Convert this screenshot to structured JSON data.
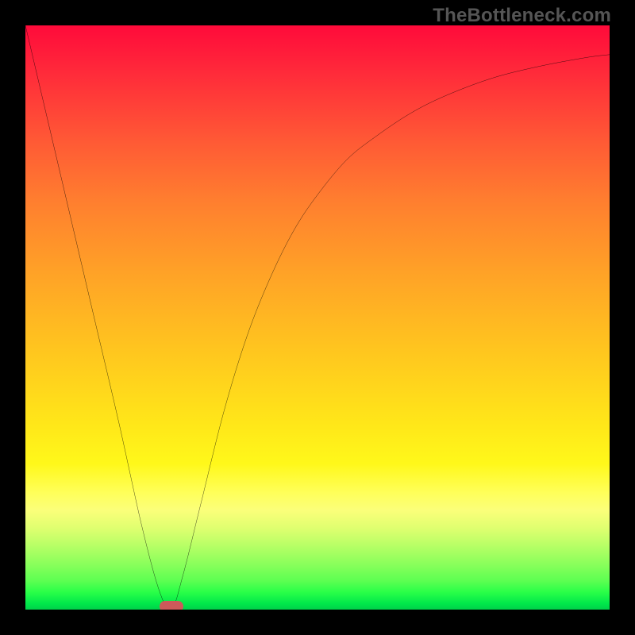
{
  "watermark_text": "TheBottleneck.com",
  "chart_data": {
    "type": "line",
    "title": "",
    "xlabel": "",
    "ylabel": "",
    "xlim": [
      0,
      100
    ],
    "ylim": [
      0,
      100
    ],
    "grid": false,
    "legend": false,
    "series": [
      {
        "name": "curve",
        "x": [
          0,
          4,
          8,
          12,
          16,
          20,
          23,
          25,
          27,
          30,
          34,
          38,
          42,
          46,
          50,
          55,
          60,
          66,
          72,
          80,
          88,
          96,
          100
        ],
        "y": [
          100,
          83,
          66,
          49,
          32,
          14,
          3,
          0,
          6,
          18,
          34,
          47,
          57,
          65,
          71,
          77,
          81,
          85,
          88,
          91,
          93,
          94.5,
          95
        ]
      }
    ],
    "marker": {
      "x": 25,
      "y": 0.6
    },
    "background_gradient": {
      "stops": [
        {
          "pos": 0.0,
          "color": "#ff0a3a"
        },
        {
          "pos": 0.08,
          "color": "#ff2a3a"
        },
        {
          "pos": 0.2,
          "color": "#ff5a35"
        },
        {
          "pos": 0.3,
          "color": "#ff7e2f"
        },
        {
          "pos": 0.42,
          "color": "#ffa127"
        },
        {
          "pos": 0.55,
          "color": "#ffc41f"
        },
        {
          "pos": 0.68,
          "color": "#ffe619"
        },
        {
          "pos": 0.75,
          "color": "#fff81a"
        },
        {
          "pos": 0.8,
          "color": "#ffff5a"
        },
        {
          "pos": 0.83,
          "color": "#fbff7a"
        },
        {
          "pos": 0.86,
          "color": "#e0ff70"
        },
        {
          "pos": 0.89,
          "color": "#b8ff66"
        },
        {
          "pos": 0.92,
          "color": "#8dff5c"
        },
        {
          "pos": 0.95,
          "color": "#5eff52"
        },
        {
          "pos": 0.97,
          "color": "#2aff48"
        },
        {
          "pos": 0.99,
          "color": "#00e84a"
        },
        {
          "pos": 1.0,
          "color": "#00d04a"
        }
      ]
    }
  }
}
